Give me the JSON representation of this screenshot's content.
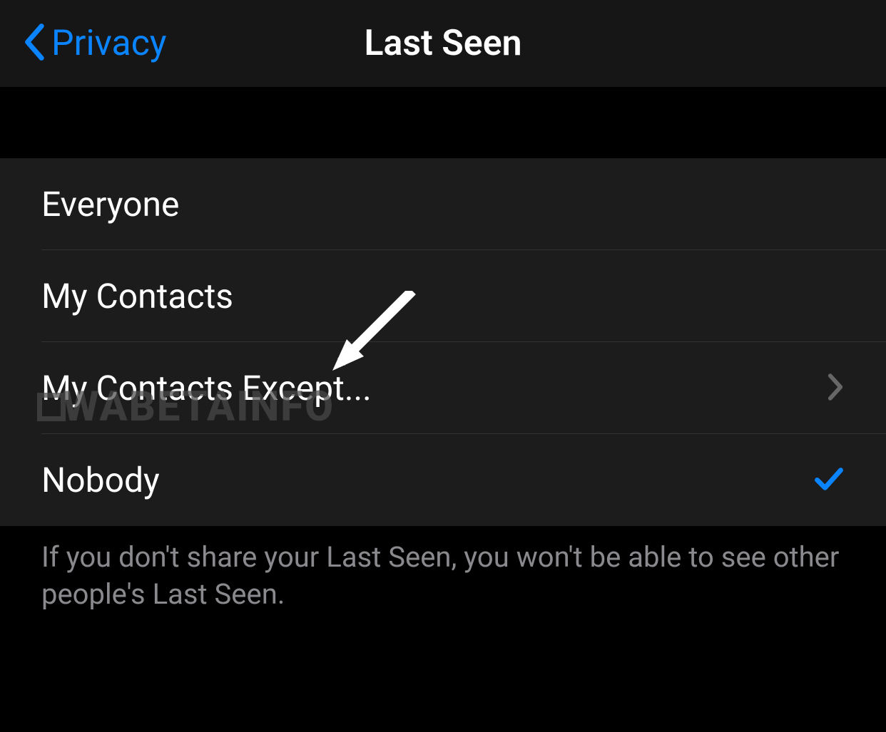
{
  "nav": {
    "back_label": "Privacy",
    "title": "Last Seen"
  },
  "options": [
    {
      "label": "Everyone",
      "selected": false,
      "disclosure": false
    },
    {
      "label": "My Contacts",
      "selected": false,
      "disclosure": false
    },
    {
      "label": "My Contacts Except...",
      "selected": false,
      "disclosure": true
    },
    {
      "label": "Nobody",
      "selected": true,
      "disclosure": false
    }
  ],
  "footer_text": "If you don't share your Last Seen, you won't be able to see other people's Last Seen.",
  "watermark": "WABETAINFO"
}
